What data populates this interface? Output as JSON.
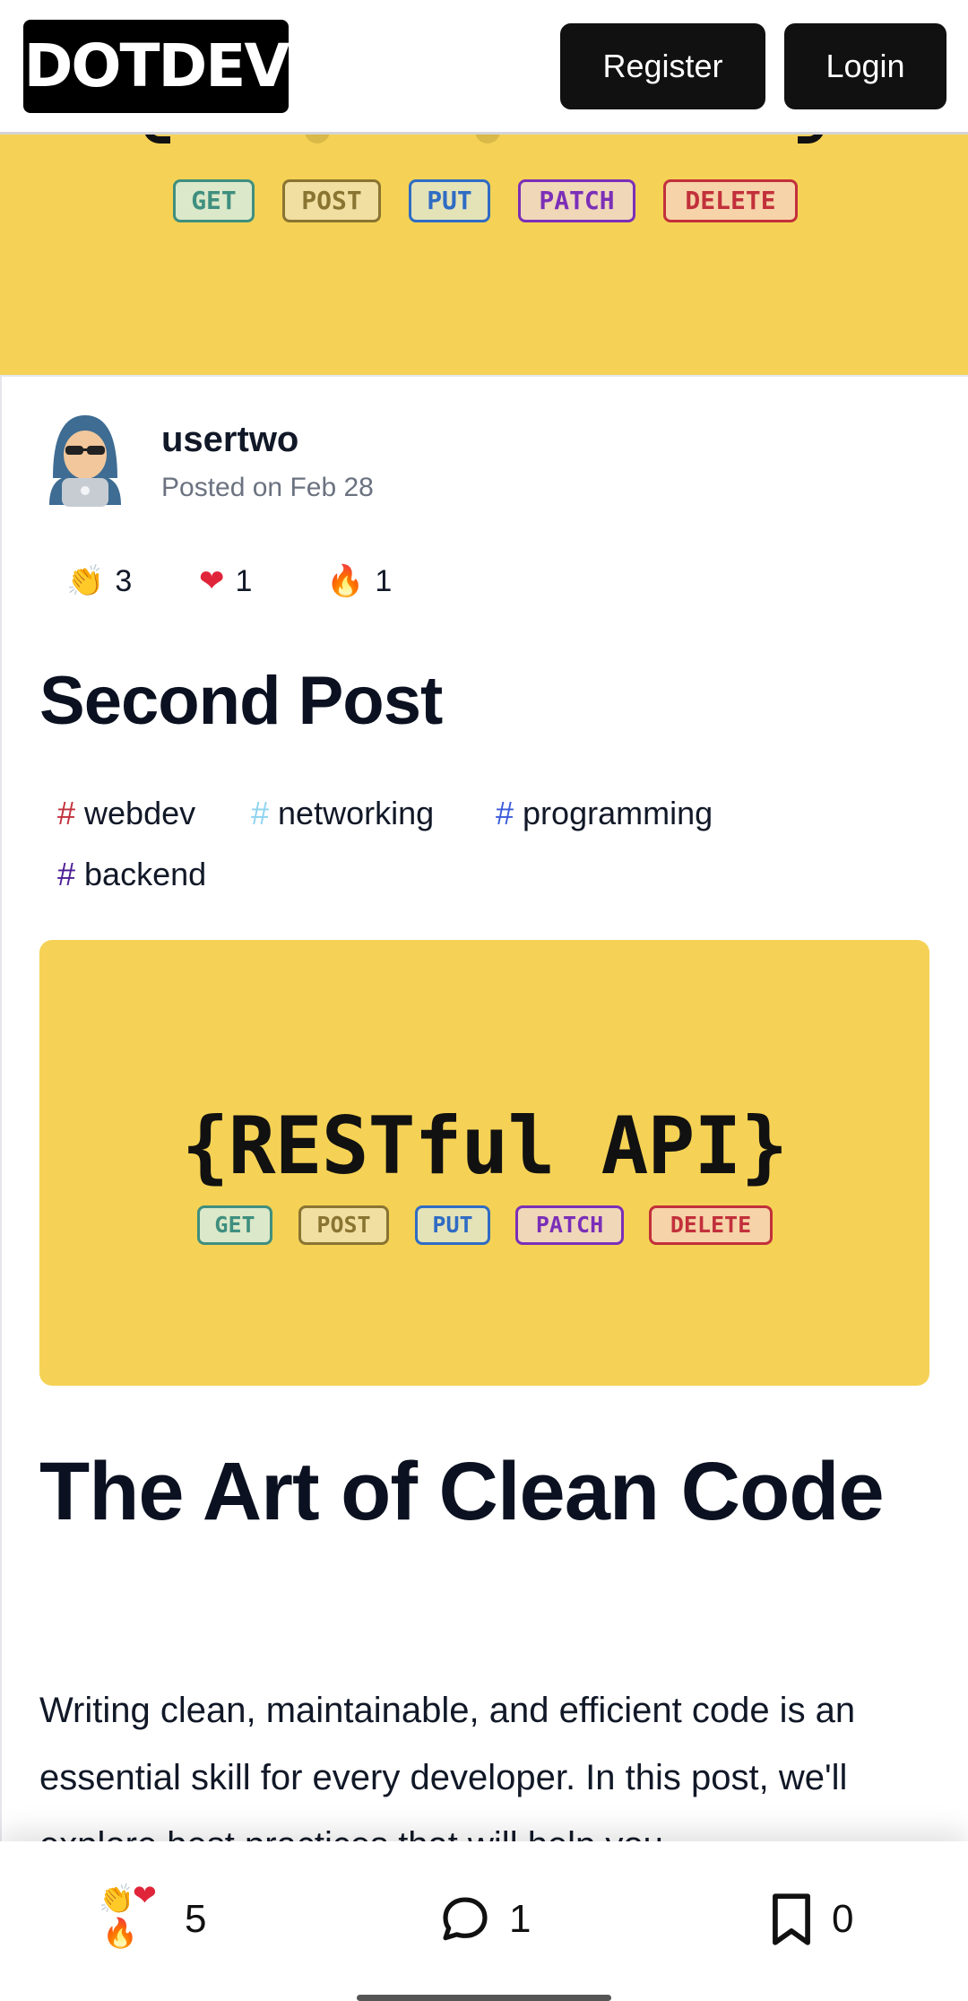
{
  "header": {
    "logo": "DOTDEV",
    "register_label": "Register",
    "login_label": "Login"
  },
  "http_methods": [
    "GET",
    "POST",
    "PUT",
    "PATCH",
    "DELETE"
  ],
  "colors": {
    "banner_yellow": "#f5d255",
    "get": "#3f8f7f",
    "post": "#8a7432",
    "put": "#2f6cc4",
    "patch": "#7b2fb8",
    "delete": "#c2303b"
  },
  "author": {
    "name": "usertwo",
    "posted": "Posted on Feb 28"
  },
  "reactions": [
    {
      "icon": "clapping-hands-icon",
      "emoji": "👏",
      "count": "3"
    },
    {
      "icon": "heart-icon",
      "emoji": "❤",
      "count": "1"
    },
    {
      "icon": "fire-icon",
      "emoji": "🔥",
      "count": "1"
    }
  ],
  "post": {
    "title": "Second Post",
    "tags": [
      {
        "name": "webdev",
        "hash": "#",
        "color": "#c2303b"
      },
      {
        "name": "networking",
        "hash": "#",
        "color": "#8ed3f0"
      },
      {
        "name": "programming",
        "hash": "#",
        "color": "#3b5bdb"
      },
      {
        "name": "backend",
        "hash": "#",
        "color": "#4c1d95"
      }
    ],
    "cover_text": "{RESTful API}",
    "article_title": "The Art of Clean Code",
    "article_body": "Writing clean, maintainable, and efficient code is an essential skill for every developer. In this post, we'll explore best practices that will help you"
  },
  "bottom_bar": {
    "reactions_count": "5",
    "comments_count": "1",
    "bookmarks_count": "0"
  }
}
